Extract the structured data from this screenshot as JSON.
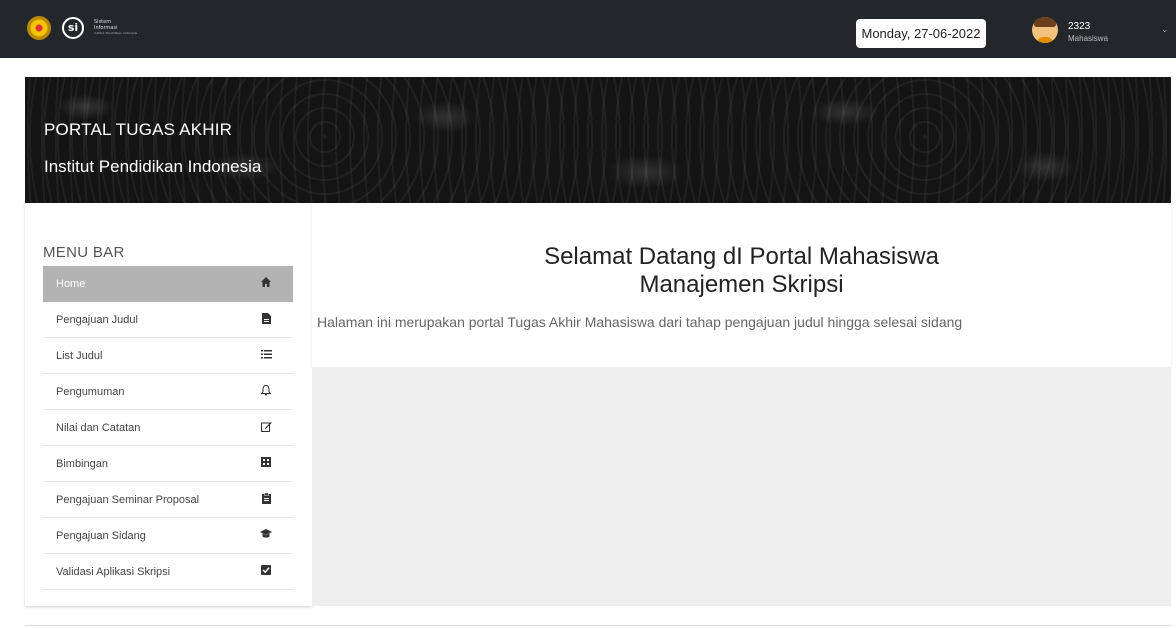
{
  "topbar": {
    "logo_lines": [
      "Sistem",
      "Informasi"
    ],
    "logo_small": "Institut Pendidikan Indonesia",
    "date": "Monday, 27-06-2022",
    "user_id": "2323",
    "user_role": "Mahasiswa",
    "icons": {
      "caret": "chevron-down-icon"
    }
  },
  "banner": {
    "title": "PORTAL TUGAS AKHIR",
    "subtitle": "Institut Pendidikan Indonesia"
  },
  "sidebar": {
    "title": "MENU BAR",
    "items": [
      {
        "label": "Home",
        "icon": "home-icon",
        "active": true
      },
      {
        "label": "Pengajuan Judul",
        "icon": "file-icon",
        "active": false
      },
      {
        "label": "List Judul",
        "icon": "list-icon",
        "active": false
      },
      {
        "label": "Pengumuman",
        "icon": "bell-icon",
        "active": false
      },
      {
        "label": "Nilai dan Catatan",
        "icon": "edit-icon",
        "active": false
      },
      {
        "label": "Bimbingan",
        "icon": "expand-icon",
        "active": false
      },
      {
        "label": "Pengajuan Seminar Proposal",
        "icon": "clipboard-icon",
        "active": false
      },
      {
        "label": "Pengajuan Sidang",
        "icon": "graduation-cap-icon",
        "active": false
      },
      {
        "label": "Validasi Aplikasi Skripsi",
        "icon": "checkbox-icon",
        "active": false
      }
    ]
  },
  "main": {
    "heading_line1": "Selamat Datang dI Portal Mahasiswa",
    "heading_line2": "Manajemen Skripsi",
    "description": "Halaman ini merupakan portal Tugas Akhir Mahasiswa dari tahap pengajuan judul hingga selesai sidang"
  },
  "colors": {
    "topbar": "#23272c",
    "active_item": "#b3b3b3",
    "page_gray": "#eeeeee"
  }
}
